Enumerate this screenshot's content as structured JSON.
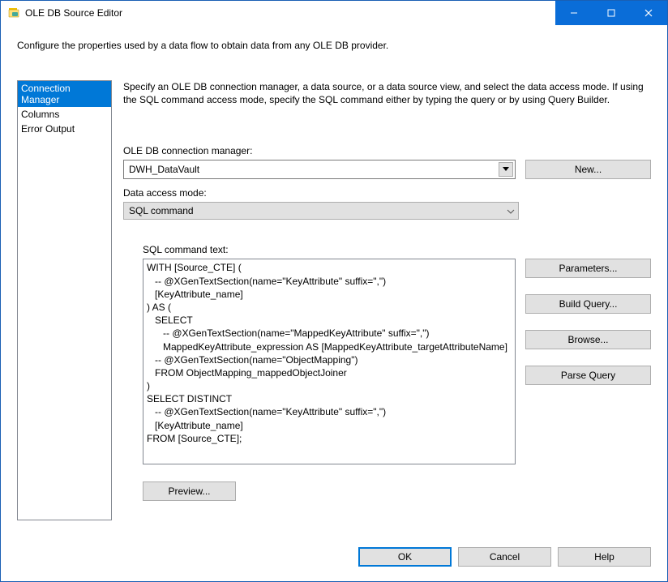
{
  "window": {
    "title": "OLE DB Source Editor"
  },
  "description": "Configure the properties used by a data flow to obtain data from any OLE DB provider.",
  "sidebar": {
    "items": [
      {
        "label": "Connection Manager",
        "selected": true
      },
      {
        "label": "Columns",
        "selected": false
      },
      {
        "label": "Error Output",
        "selected": false
      }
    ]
  },
  "content": {
    "intro": "Specify an OLE DB connection manager, a data source, or a data source view, and select the data access mode. If using the SQL command access mode, specify the SQL command either by typing the query or by using Query Builder.",
    "conn_label": "OLE DB connection manager:",
    "conn_value": "DWH_DataVault",
    "new_button": "New...",
    "mode_label": "Data access mode:",
    "mode_value": "SQL command",
    "sql_label": "SQL command text:",
    "sql_text": "WITH [Source_CTE] (\n   -- @XGenTextSection(name=\"KeyAttribute\" suffix=\",\")\n   [KeyAttribute_name]\n) AS (\n   SELECT\n      -- @XGenTextSection(name=\"MappedKeyAttribute\" suffix=\",\")\n      MappedKeyAttribute_expression AS [MappedKeyAttribute_targetAttributeName]\n   -- @XGenTextSection(name=\"ObjectMapping\")\n   FROM ObjectMapping_mappedObjectJoiner\n)\nSELECT DISTINCT\n   -- @XGenTextSection(name=\"KeyAttribute\" suffix=\",\")\n   [KeyAttribute_name]\nFROM [Source_CTE];",
    "side_buttons": {
      "parameters": "Parameters...",
      "build_query": "Build Query...",
      "browse": "Browse...",
      "parse_query": "Parse Query"
    },
    "preview": "Preview..."
  },
  "footer": {
    "ok": "OK",
    "cancel": "Cancel",
    "help": "Help"
  }
}
